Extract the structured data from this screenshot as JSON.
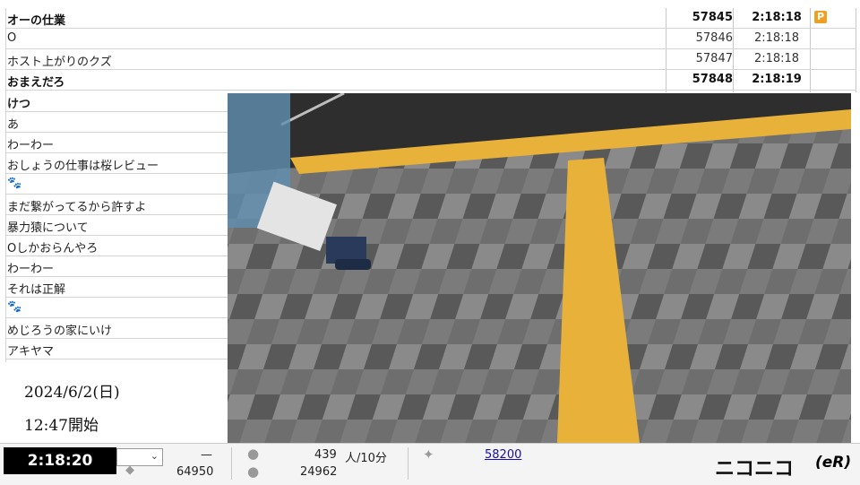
{
  "comments_full": [
    {
      "text": "オーの仕業",
      "no": "57845",
      "time": "2:18:18",
      "bold": true,
      "premium": "P"
    },
    {
      "text": "O",
      "no": "57846",
      "time": "2:18:18",
      "bold": false
    },
    {
      "text": "ホスト上がりのクズ",
      "no": "57847",
      "time": "2:18:18",
      "bold": false
    },
    {
      "text": "おまえだろ",
      "no": "57848",
      "time": "2:18:19",
      "bold": true
    }
  ],
  "comments_left": [
    {
      "text": "けつ",
      "bold": true
    },
    {
      "text": "あ"
    },
    {
      "text": "わーわー"
    },
    {
      "text": "おしょうの仕事は桜レビュー"
    },
    {
      "text": "🐾"
    },
    {
      "text": "まだ繋がってるから許すよ"
    },
    {
      "text": "暴力猿について"
    },
    {
      "text": "Oしかおらんやろ"
    },
    {
      "text": "わーわー"
    },
    {
      "text": "それは正解"
    },
    {
      "text": "🐾"
    },
    {
      "text": "めじろうの家にいけ"
    },
    {
      "text": "アキヤマ"
    }
  ],
  "info": {
    "date": "2024/6/2(日)",
    "start": "12:47開始"
  },
  "bottom": {
    "clock": "2:18:20",
    "dash": "—",
    "viewers": "64950",
    "rate_value": "439",
    "rate_unit": "人/10分",
    "comments": "24962",
    "ad_points": "58200",
    "logo": "ニコニコ",
    "logo_suffix": "(eR)"
  },
  "colors": {
    "premium_badge": "#f0a020",
    "clock_bg": "#000000",
    "tactile": "#e8b23a"
  }
}
